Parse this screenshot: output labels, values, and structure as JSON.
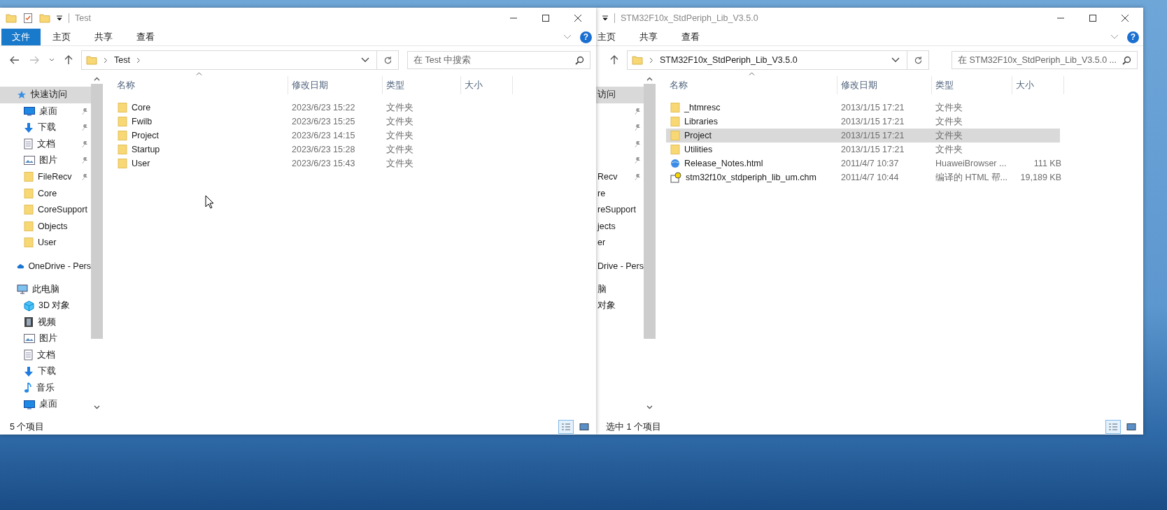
{
  "windows": [
    {
      "kind": "front",
      "title": "Test",
      "ribbon_tabs": [
        {
          "label": "文件",
          "selected": true
        },
        {
          "label": "主页",
          "selected": false
        },
        {
          "label": "共享",
          "selected": false
        },
        {
          "label": "查看",
          "selected": false
        }
      ],
      "help": "?",
      "address": {
        "path": [
          "Test"
        ]
      },
      "search": {
        "placeholder": "在 Test 中搜索"
      },
      "columns": [
        "名称",
        "修改日期",
        "类型",
        "大小"
      ],
      "sidebar": [
        {
          "label": "快速访问",
          "kind": "star",
          "selected": true,
          "children": [
            {
              "label": "桌面",
              "kind": "desktop",
              "pinned": true,
              "selected": false
            },
            {
              "label": "下载",
              "kind": "download",
              "pinned": true,
              "selected": false
            },
            {
              "label": "文档",
              "kind": "document",
              "pinned": true,
              "selected": false
            },
            {
              "label": "图片",
              "kind": "picture",
              "pinned": true,
              "selected": false
            },
            {
              "label": "FileRecv",
              "kind": "folder",
              "pinned": true,
              "selected": false
            },
            {
              "label": "Core",
              "kind": "folder",
              "pinned": false,
              "selected": false
            },
            {
              "label": "CoreSupport",
              "kind": "folder",
              "pinned": false,
              "selected": false
            },
            {
              "label": "Objects",
              "kind": "folder",
              "pinned": false,
              "selected": false
            },
            {
              "label": "User",
              "kind": "folder",
              "pinned": false,
              "selected": false
            }
          ]
        },
        {
          "label": "OneDrive - Pers",
          "kind": "cloud",
          "selected": false
        },
        {
          "label": "此电脑",
          "kind": "pc",
          "selected": false,
          "children": [
            {
              "label": "3D 对象",
              "kind": "cube",
              "selected": false
            },
            {
              "label": "视频",
              "kind": "film",
              "selected": false
            },
            {
              "label": "图片",
              "kind": "picture",
              "selected": false
            },
            {
              "label": "文档",
              "kind": "document",
              "selected": false
            },
            {
              "label": "下载",
              "kind": "download",
              "selected": false
            },
            {
              "label": "音乐",
              "kind": "music",
              "selected": false
            },
            {
              "label": "桌面",
              "kind": "desktop",
              "selected": false
            }
          ]
        }
      ],
      "files": [
        {
          "name": "Core",
          "kind": "folder",
          "modified": "2023/6/23 15:22",
          "type": "文件夹",
          "selected": false
        },
        {
          "name": "Fwilb",
          "kind": "folder",
          "modified": "2023/6/23 15:25",
          "type": "文件夹",
          "selected": false
        },
        {
          "name": "Project",
          "kind": "folder",
          "modified": "2023/6/23 14:15",
          "type": "文件夹",
          "selected": false
        },
        {
          "name": "Startup",
          "kind": "folder",
          "modified": "2023/6/23 15:28",
          "type": "文件夹",
          "selected": false
        },
        {
          "name": "User",
          "kind": "folder",
          "modified": "2023/6/23 15:43",
          "type": "文件夹",
          "selected": false
        }
      ],
      "status": "5 个项目",
      "views": [
        {
          "kind": "details",
          "selected": true
        },
        {
          "kind": "large-icons",
          "selected": false
        }
      ]
    },
    {
      "kind": "back",
      "title": "STM32F10x_StdPeriph_Lib_V3.5.0",
      "ribbon_tabs": [
        {
          "label": "主页",
          "selected": false
        },
        {
          "label": "共享",
          "selected": false
        },
        {
          "label": "查看",
          "selected": false
        }
      ],
      "help": "?",
      "address": {
        "path": [
          "STM32F10x_StdPeriph_Lib_V3.5.0"
        ]
      },
      "search": {
        "placeholder": "在 STM32F10x_StdPeriph_Lib_V3.5.0 ..."
      },
      "columns": [
        "名称",
        "修改日期",
        "类型",
        "大小"
      ],
      "sidebar_fragments": [
        {
          "label": "访问",
          "kind": "item",
          "selected": true,
          "pinned": false
        },
        {
          "kind": "item",
          "selected": false,
          "pinned": true
        },
        {
          "kind": "item",
          "selected": false,
          "pinned": true
        },
        {
          "kind": "item",
          "selected": false,
          "pinned": true
        },
        {
          "kind": "item",
          "selected": false,
          "pinned": true
        },
        {
          "label": "Recv",
          "kind": "item",
          "selected": false,
          "pinned": true
        },
        {
          "label": "re",
          "kind": "item",
          "selected": false,
          "pinned": false
        },
        {
          "label": "reSupport",
          "kind": "item",
          "selected": false,
          "pinned": false
        },
        {
          "label": "jects",
          "kind": "item",
          "selected": false,
          "pinned": false
        },
        {
          "label": "er",
          "kind": "item",
          "selected": false,
          "pinned": false
        },
        {
          "label": "Drive - Pers",
          "kind": "section",
          "selected": false,
          "pinned": false
        },
        {
          "label": "脑",
          "kind": "section",
          "selected": false,
          "pinned": false
        },
        {
          "label": "对象",
          "kind": "item",
          "selected": false,
          "pinned": false
        }
      ],
      "files": [
        {
          "name": "_htmresc",
          "kind": "folder",
          "modified": "2013/1/15 17:21",
          "type": "文件夹",
          "selected": false
        },
        {
          "name": "Libraries",
          "kind": "folder",
          "modified": "2013/1/15 17:21",
          "type": "文件夹",
          "selected": false
        },
        {
          "name": "Project",
          "kind": "folder",
          "modified": "2013/1/15 17:21",
          "type": "文件夹",
          "selected": true
        },
        {
          "name": "Utilities",
          "kind": "folder",
          "modified": "2013/1/15 17:21",
          "type": "文件夹",
          "selected": false
        },
        {
          "name": "Release_Notes.html",
          "kind": "html",
          "modified": "2011/4/7 10:37",
          "type": "HuaweiBrowser ...",
          "size": "111 KB",
          "selected": false
        },
        {
          "name": "stm32f10x_stdperiph_lib_um.chm",
          "kind": "chm",
          "modified": "2011/4/7 10:44",
          "type": "编译的 HTML 帮...",
          "size": "19,189 KB",
          "selected": false
        }
      ],
      "status": "选中 1 个项目",
      "views": [
        {
          "kind": "details",
          "selected": true
        },
        {
          "kind": "large-icons",
          "selected": false
        }
      ]
    }
  ]
}
